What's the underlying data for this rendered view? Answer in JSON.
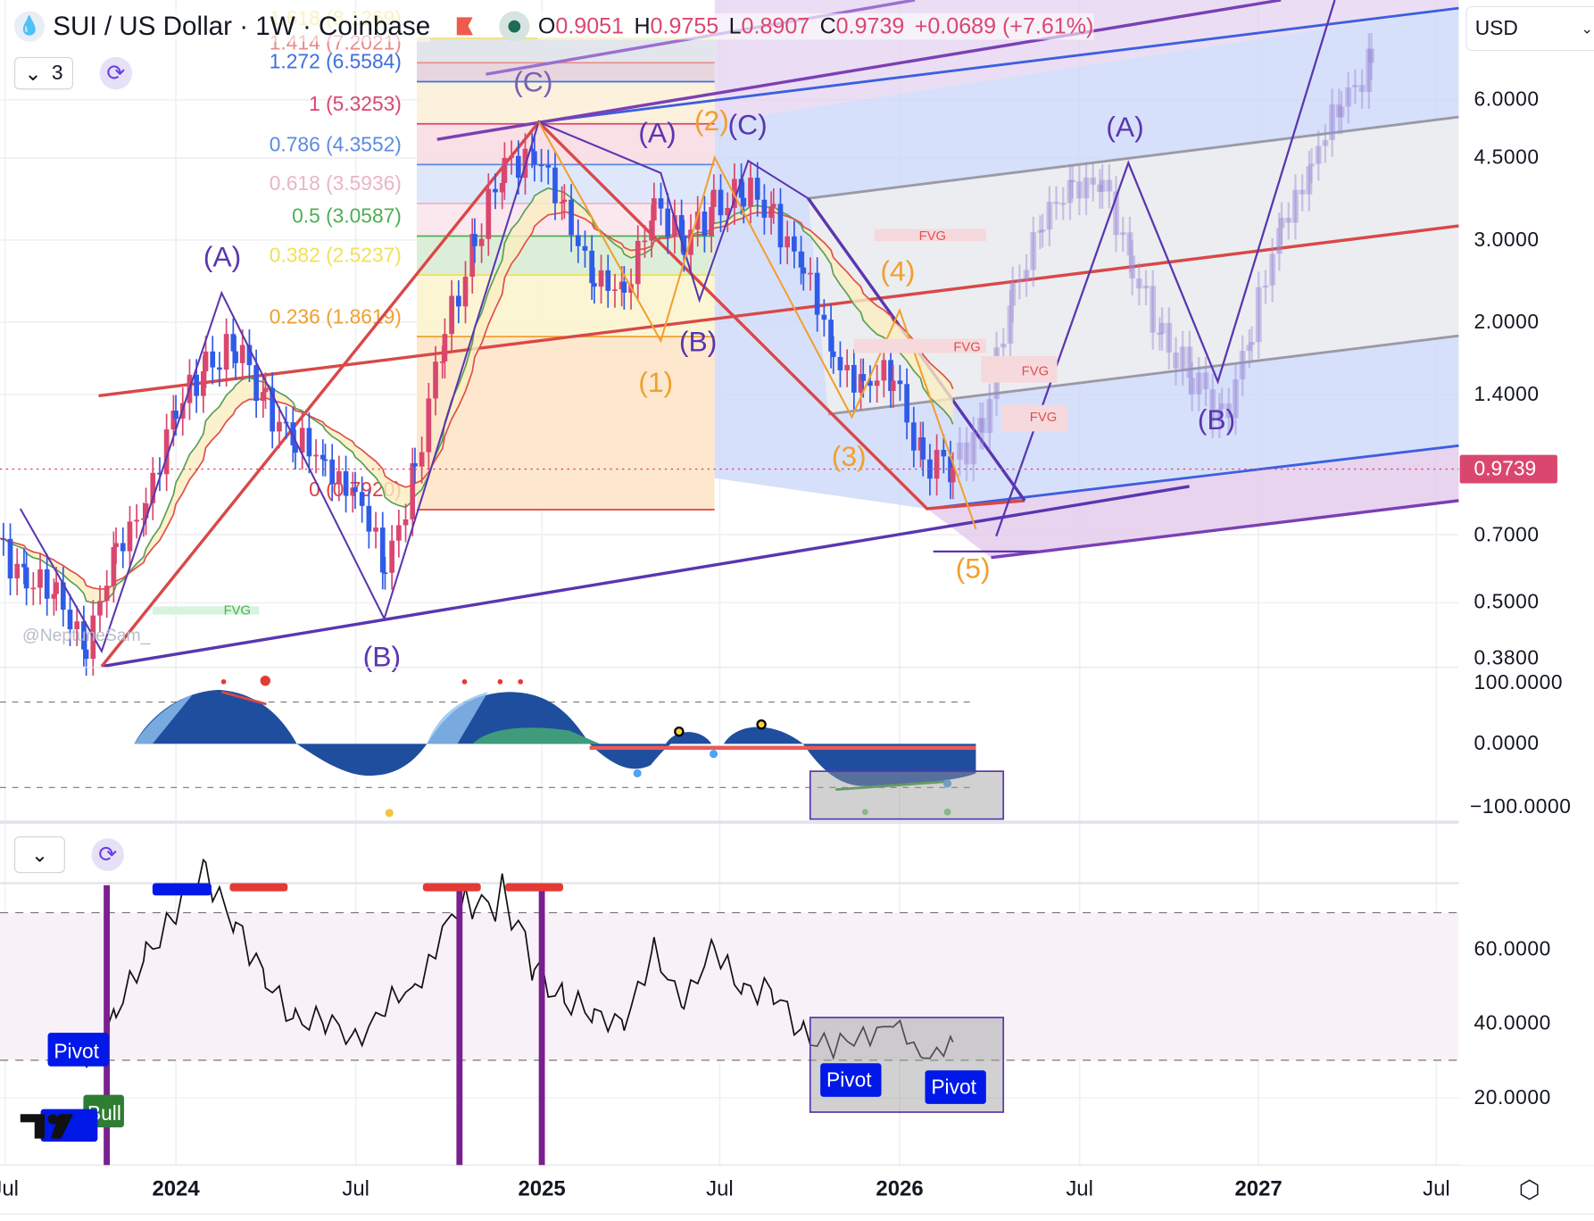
{
  "header": {
    "symbol_title": "SUI / US Dollar · 1W · Coinbase",
    "ohlc": [
      {
        "k": "O",
        "v": "0.9051"
      },
      {
        "k": "H",
        "v": "0.9755"
      },
      {
        "k": "L",
        "v": "0.8907"
      },
      {
        "k": "C",
        "v": "0.9739"
      }
    ],
    "change": "+0.0689 (+7.61%)"
  },
  "controls": {
    "main_collapse_count": "3",
    "chevron": "⌄",
    "sync_icon": "⟳"
  },
  "currency": {
    "label": "USD",
    "chevron": "⌄"
  },
  "price_axis": [
    "6.0000",
    "4.5000",
    "3.0000",
    "2.0000",
    "1.4000",
    "0.7000",
    "0.5000",
    "0.3800"
  ],
  "last_price": "0.9739",
  "osc_axis": [
    "100.0000",
    "0.0000",
    "−100.0000"
  ],
  "rsi_axis": [
    "60.0000",
    "40.0000",
    "20.0000"
  ],
  "time_axis": [
    "Jul",
    "2024",
    "Jul",
    "2025",
    "Jul",
    "2026",
    "Jul",
    "2027",
    "Jul"
  ],
  "watermark": "@NeptuneSam_",
  "colors": {
    "up": "#d9476f",
    "down": "#2f5be8",
    "accent": "#6a3de8",
    "channel_blue": "#3b5fe0",
    "channel_purple": "#7b3fb5",
    "median_red": "#d94848"
  },
  "fib_levels": [
    {
      "label": "1.618 (8.1269)",
      "price": 8.1269,
      "color": "#f2e27a"
    },
    {
      "label": "1.414 (7.2021)",
      "price": 7.2021,
      "color": "#e88a8a"
    },
    {
      "label": "1.272 (6.5584)",
      "price": 6.5584,
      "color": "#3f6ee0"
    },
    {
      "label": "1 (5.3253)",
      "price": 5.3253,
      "color": "#d9476f"
    },
    {
      "label": "0.786 (4.3552)",
      "price": 4.3552,
      "color": "#5b8be0"
    },
    {
      "label": "0.618 (3.5936)",
      "price": 3.5936,
      "color": "#ebb5c4"
    },
    {
      "label": "0.5 (3.0587)",
      "price": 3.0587,
      "color": "#4caf50"
    },
    {
      "label": "0.382 (2.5237)",
      "price": 2.5237,
      "color": "#f2e05a"
    },
    {
      "label": "0.236 (1.8619)",
      "price": 1.8619,
      "color": "#f0a030"
    },
    {
      "label": "0 (0.7920)",
      "price": 0.792,
      "color": "#e04040"
    }
  ],
  "wave_labels": {
    "a1": "(A)",
    "b1": "(B)",
    "c1": "(C)",
    "a2": "(A)",
    "b2": "(B)",
    "c2": "(C)",
    "w1": "(1)",
    "w2": "(2)",
    "w3": "(3)",
    "w4": "(4)",
    "w5": "(5)",
    "fa": "(A)",
    "fb": "(B)"
  },
  "fvg": [
    "FVG",
    "FVG",
    "FVG",
    "FVG",
    "FVG"
  ],
  "rsi_labels": {
    "pivot": "Pivot",
    "bull": "Bull"
  },
  "chart_data": {
    "type": "candlestick",
    "title": "SUI / US Dollar · 1W · Coinbase",
    "scale": "log",
    "ylim": [
      0.38,
      6.0
    ],
    "monthly_closes_from_2023_07": [
      0.66,
      0.58,
      0.5,
      0.42,
      0.62,
      0.85,
      1.25,
      1.65,
      1.75,
      1.35,
      1.1,
      1.0,
      0.85,
      0.6,
      0.95,
      1.9,
      3.0,
      4.2,
      4.8,
      3.3,
      2.6,
      2.2,
      3.7,
      2.9,
      3.6,
      3.8,
      3.4,
      2.6,
      1.7,
      1.45,
      1.55,
      1.0,
      0.9739
    ],
    "projection_monthly_from_2026_04": [
      1.25,
      2.2,
      3.5,
      3.7,
      4.2,
      2.5,
      1.9,
      1.5,
      1.25,
      1.9,
      3.3,
      4.3,
      6.0,
      7.2
    ],
    "rsi_monthly_from_2023_10": [
      27,
      45,
      56,
      74,
      77,
      70,
      50,
      42,
      40,
      36,
      44,
      50,
      66,
      73,
      74,
      55,
      47,
      41,
      42,
      57,
      48,
      58,
      51,
      47,
      38,
      33,
      37,
      40,
      31,
      35
    ],
    "rsi_ylim": [
      10,
      80
    ]
  }
}
